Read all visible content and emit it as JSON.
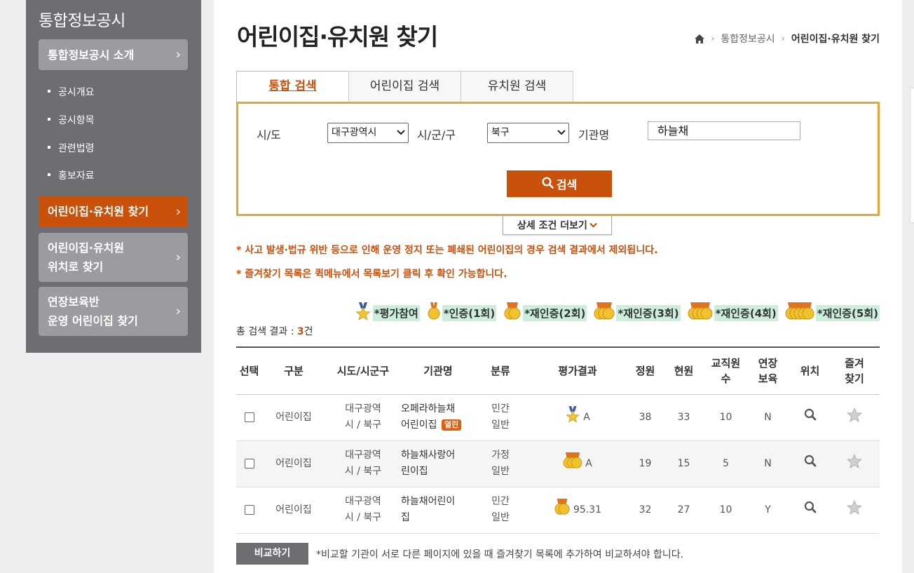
{
  "sidebar": {
    "title": "통합정보공시",
    "menu": [
      {
        "label": "통합정보공시 소개",
        "chevron": "›"
      },
      {
        "label": "어린이집·유치원 찾기",
        "chevron": "›"
      },
      {
        "label1": "어린이집·유치원",
        "label2": "위치로 찾기",
        "chevron": "›"
      },
      {
        "label1": "연장보육반",
        "label2": "운영 어린이집 찾기",
        "chevron": "›"
      }
    ],
    "sub_items": [
      "공시개요",
      "공시항목",
      "관련법령",
      "홍보자료"
    ]
  },
  "page": {
    "title": "어린이집·유치원 찾기",
    "breadcrumb": {
      "sep": "›",
      "level1": "통합정보공시",
      "current": "어린이집·유치원 찾기"
    }
  },
  "tabs": [
    "통합 검색",
    "어린이집 검색",
    "유치원 검색"
  ],
  "search": {
    "sido_label": "시/도",
    "sido_value": "대구광역시",
    "sigungu_label": "시/군/구",
    "sigungu_value": "북구",
    "name_label": "기관명",
    "name_value": "하늘채",
    "button": "검색",
    "more_button": "상세 조건 더보기"
  },
  "notices": [
    "* 사고 발생·법규 위반 등으로 인해 운영 정지 또는 폐쇄된 어린이집의 경우 검색 결과에서 제외됩니다.",
    "* 즐겨찾기 목록은 퀵메뉴에서 목록보기 클릭 후 확인 가능합니다."
  ],
  "legend": [
    "*평가참여",
    "*인증(1회)",
    "*재인증(2회)",
    "*재인증(3회)",
    "*재인증(4회)",
    "*재인증(5회)"
  ],
  "result": {
    "prefix": "총 검색 결과 : ",
    "count": "3",
    "suffix": "건"
  },
  "table": {
    "headers": {
      "select": "선택",
      "type": "구분",
      "region": "시도/시군구",
      "name": "기관명",
      "category": "분류",
      "eval": "평가결과",
      "capacity": "정원",
      "current": "현원",
      "staff1": "교직원",
      "staff2": "수",
      "ext1": "연장",
      "ext2": "보육",
      "location": "위치",
      "fav1": "즐겨",
      "fav2": "찾기"
    },
    "rows": [
      {
        "type": "어린이집",
        "region1": "대구광역",
        "region2": "시 / 북구",
        "name1": "오페라하늘채",
        "name2": "어린이집",
        "badge": "열린",
        "cat1": "민간",
        "cat2": "일반",
        "eval": "A",
        "medals": "evaluation-participation",
        "capacity": "38",
        "current": "33",
        "staff": "10",
        "ext": "N"
      },
      {
        "type": "어린이집",
        "region1": "대구광역",
        "region2": "시 / 북구",
        "name1": "하늘채사랑어",
        "name2": "린이집",
        "badge": "",
        "cat1": "가정",
        "cat2": "일반",
        "eval": "A",
        "medals": "re-certification-3",
        "capacity": "19",
        "current": "15",
        "staff": "5",
        "ext": "N"
      },
      {
        "type": "어린이집",
        "region1": "대구광역",
        "region2": "시 / 북구",
        "name1": "하늘채어린이",
        "name2": "집",
        "badge": "",
        "cat1": "민간",
        "cat2": "일반",
        "eval": "95.31",
        "medals": "re-certification-2",
        "capacity": "32",
        "current": "27",
        "staff": "10",
        "ext": "Y"
      }
    ]
  },
  "compare": {
    "button": "비교하기",
    "note": "*비교할 기관이 서로 다른 페이지에 있을 때 즐겨찾기 목록에 추가하여 비교하셔야 합니다."
  },
  "colors": {
    "accent": "#c9510c",
    "sidebar": "#6d6e71",
    "search_border": "#e8a53a"
  }
}
